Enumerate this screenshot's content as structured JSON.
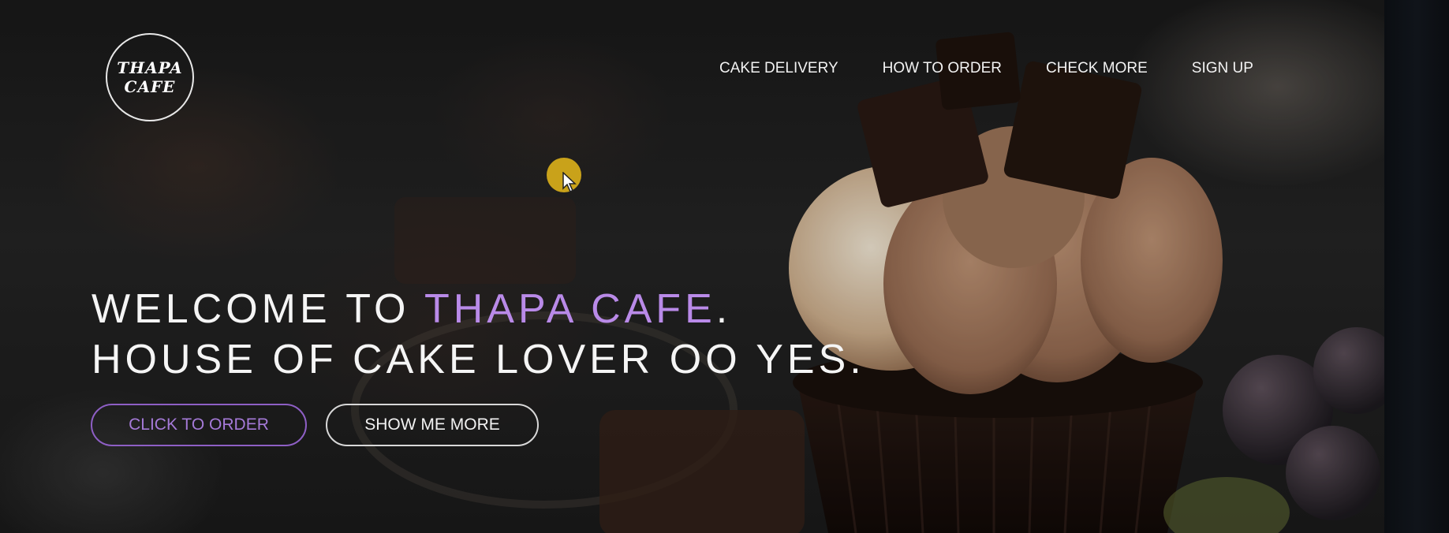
{
  "logo": {
    "line1": "THAPA",
    "line2": "CAFE"
  },
  "nav": {
    "items": [
      {
        "label": "CAKE DELIVERY"
      },
      {
        "label": "HOW TO ORDER"
      },
      {
        "label": "CHECK MORE"
      },
      {
        "label": "SIGN UP"
      }
    ]
  },
  "hero": {
    "line1_prefix": "WELCOME TO ",
    "line1_accent": "THAPA CAFE",
    "line1_suffix": ".",
    "line2": "HOUSE OF CAKE LOVER OO YES."
  },
  "buttons": {
    "order_label": "CLICK TO ORDER",
    "more_label": "SHOW ME MORE"
  },
  "colors": {
    "accent": "#b98ae8",
    "button_border_accent": "#8e5fc5",
    "cursor_highlight": "#c9a21a"
  }
}
